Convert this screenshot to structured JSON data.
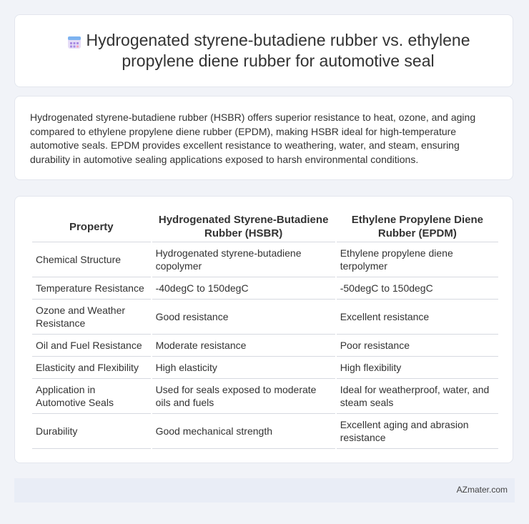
{
  "header": {
    "title": "Hydrogenated styrene-butadiene rubber vs. ethylene propylene diene rubber for automotive seal",
    "icon": "calendar-icon"
  },
  "summary": {
    "text": "Hydrogenated styrene-butadiene rubber (HSBR) offers superior resistance to heat, ozone, and aging compared to ethylene propylene diene rubber (EPDM), making HSBR ideal for high-temperature automotive seals. EPDM provides excellent resistance to weathering, water, and steam, ensuring durability in automotive sealing applications exposed to harsh environmental conditions."
  },
  "table": {
    "headers": [
      "Property",
      "Hydrogenated Styrene-Butadiene Rubber (HSBR)",
      "Ethylene Propylene Diene Rubber (EPDM)"
    ],
    "rows": [
      [
        "Chemical Structure",
        "Hydrogenated styrene-butadiene copolymer",
        "Ethylene propylene diene terpolymer"
      ],
      [
        "Temperature Resistance",
        "-40degC to 150degC",
        "-50degC to 150degC"
      ],
      [
        "Ozone and Weather Resistance",
        "Good resistance",
        "Excellent resistance"
      ],
      [
        "Oil and Fuel Resistance",
        "Moderate resistance",
        "Poor resistance"
      ],
      [
        "Elasticity and Flexibility",
        "High elasticity",
        "High flexibility"
      ],
      [
        "Application in Automotive Seals",
        "Used for seals exposed to moderate oils and fuels",
        "Ideal for weatherproof, water, and steam seals"
      ],
      [
        "Durability",
        "Good mechanical strength",
        "Excellent aging and abrasion resistance"
      ]
    ]
  },
  "footer": {
    "source": "AZmater.com"
  },
  "colors": {
    "background": "#f1f3f8",
    "card": "#ffffff",
    "footer": "#e9edf6"
  }
}
